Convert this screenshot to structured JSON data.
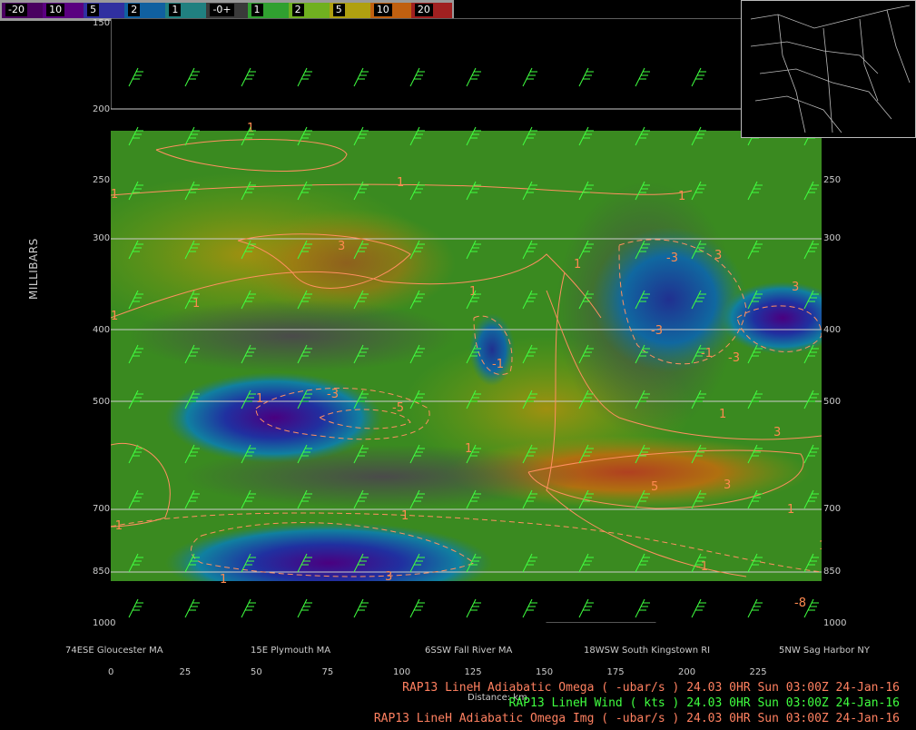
{
  "colorbar": {
    "labels": [
      "-20",
      "10",
      "5",
      "2",
      "1",
      "-0+",
      "1",
      "2",
      "5",
      "10",
      "20"
    ],
    "colors": [
      "#4a0060",
      "#5a0080",
      "#3030a0",
      "#1060a0",
      "#208080",
      "#3a3a3a",
      "#30a030",
      "#70b020",
      "#b0a010",
      "#c06010",
      "#a02020"
    ]
  },
  "y_axis": {
    "title": "MILLIBARS",
    "left_ticks": [
      "150",
      "200",
      "250",
      "300",
      "400",
      "500",
      "700",
      "850",
      "1000"
    ],
    "right_ticks": [
      "250",
      "300",
      "400",
      "500",
      "700",
      "850",
      "1000"
    ]
  },
  "locations": [
    "74ESE Gloucester MA",
    "15E Plymouth MA",
    "6SSW Fall River MA",
    "18WSW South Kingstown RI",
    "5NW Sag Harbor NY"
  ],
  "distance": {
    "ticks": [
      "0",
      "25",
      "50",
      "75",
      "100",
      "125",
      "150",
      "175",
      "200",
      "225"
    ],
    "label": "Distance: km"
  },
  "contour_labels": [
    "1",
    "1",
    "1",
    "1",
    "3",
    "1",
    "1",
    "3",
    "1",
    "-1",
    "-3",
    "-3",
    "-5",
    "1",
    "-3",
    "1",
    "3",
    "-3",
    "-1",
    "1",
    "1",
    "5",
    "3",
    "3",
    "1",
    "-1",
    "1",
    "-1",
    "1",
    "3",
    "1",
    "-8"
  ],
  "legend": [
    {
      "text": "RAP13 LineH Adiabatic Omega ( -ubar/s )   24.03   0HR Sun 03:00Z 24-Jan-16",
      "color": "#ff8060"
    },
    {
      "text": "RAP13 LineH Wind ( kts )   24.03   0HR Sun 03:00Z 24-Jan-16",
      "color": "#40ff40"
    },
    {
      "text": "RAP13 LineH Adiabatic Omega Img ( -ubar/s )   24.03   0HR Sun 03:00Z 24-Jan-16",
      "color": "#ff8060"
    }
  ]
}
